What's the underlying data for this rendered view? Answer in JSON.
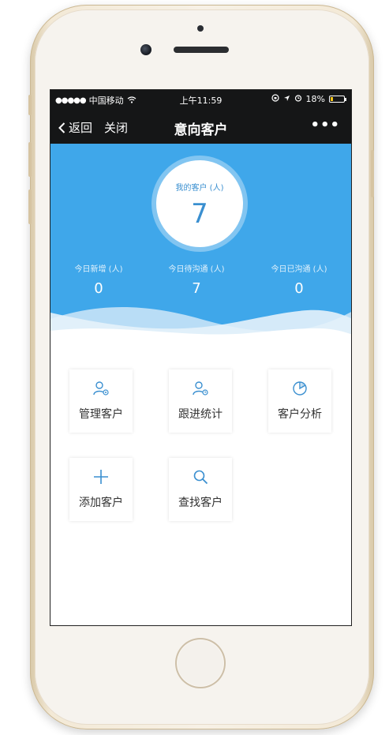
{
  "status_bar": {
    "signal_dots": "●●●●●",
    "carrier": "中国移动",
    "time": "上午11:59",
    "battery": "18%",
    "battery_level": 0.18
  },
  "nav": {
    "back_label": "返回",
    "close_label": "关闭",
    "title": "意向客户",
    "more_label": "•••"
  },
  "summary": {
    "my_customers_label": "我的客户 (人)",
    "my_customers_value": "7",
    "stats": [
      {
        "label": "今日新增 (人)",
        "value": "0"
      },
      {
        "label": "今日待沟通 (人)",
        "value": "7"
      },
      {
        "label": "今日已沟通 (人)",
        "value": "0"
      }
    ]
  },
  "actions": [
    {
      "label": "管理客户",
      "icon": "manage-customers-icon"
    },
    {
      "label": "跟进统计",
      "icon": "follow-up-stats-icon"
    },
    {
      "label": "客户分析",
      "icon": "pie-chart-icon"
    },
    {
      "label": "添加客户",
      "icon": "plus-icon"
    },
    {
      "label": "查找客户",
      "icon": "search-icon"
    }
  ],
  "colors": {
    "accent": "#3fa7ea",
    "nav_bg": "#151617",
    "icon": "#3a8fd0"
  }
}
